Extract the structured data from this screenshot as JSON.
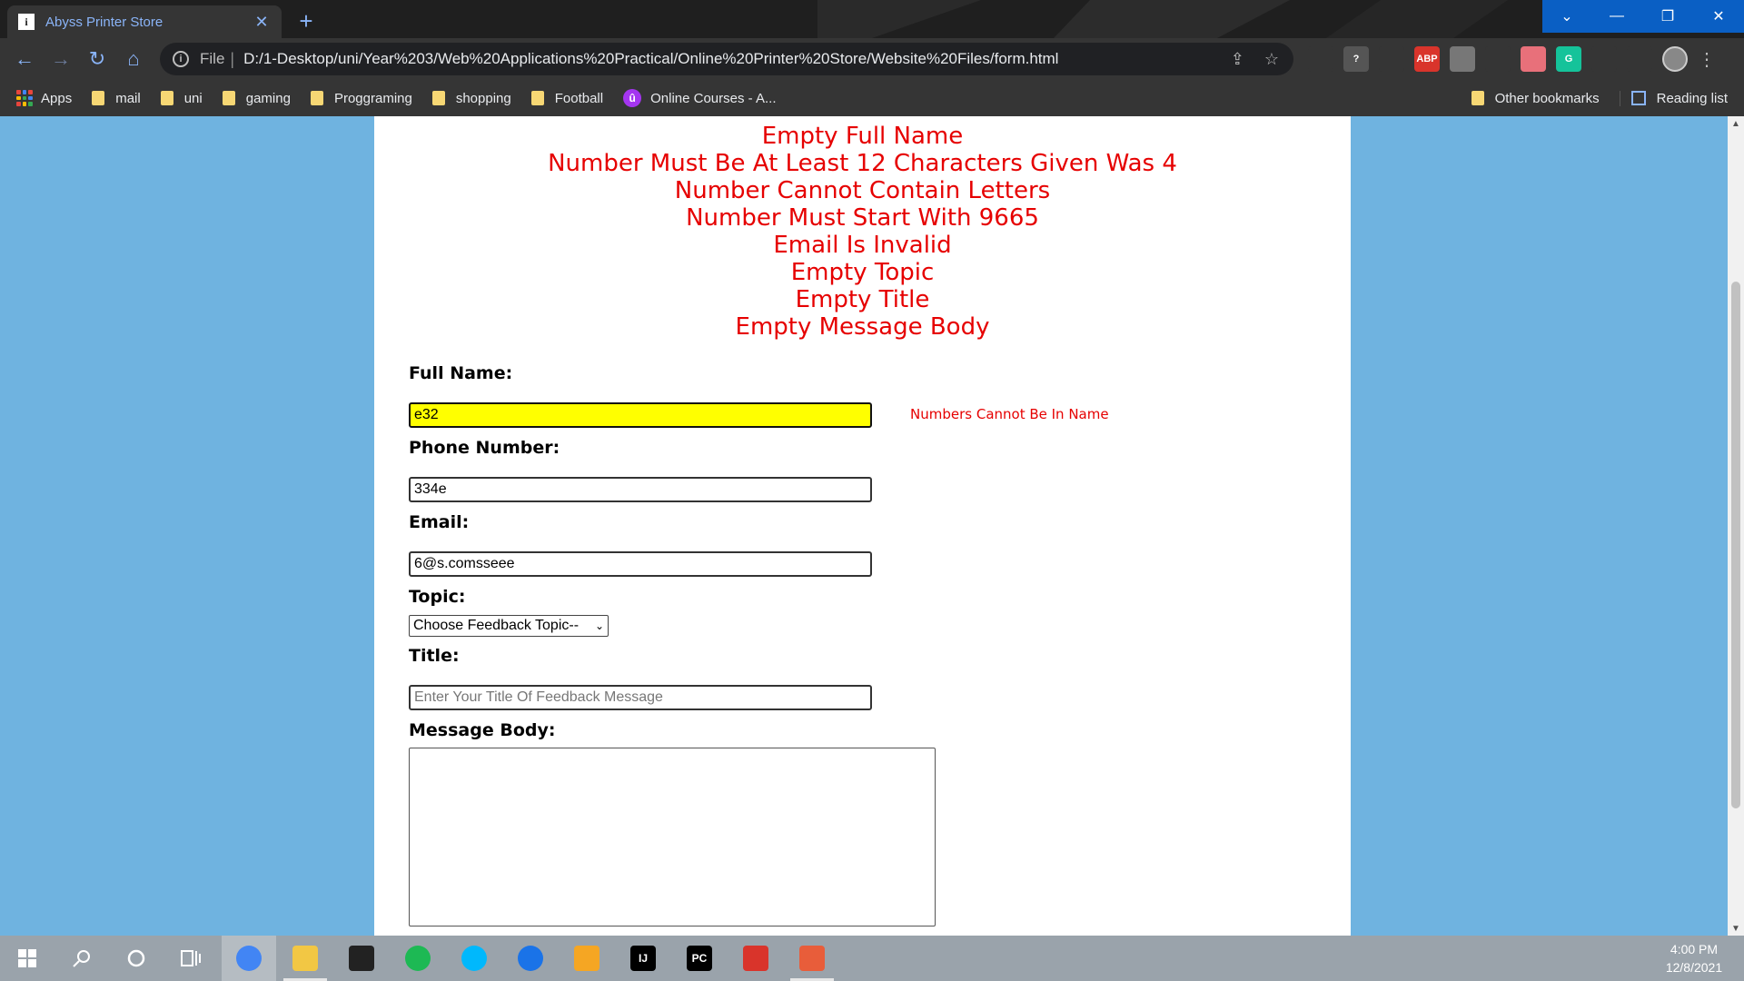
{
  "browser": {
    "tab_title": "Abyss Printer Store",
    "tab_favicon_letter": "i",
    "url_scheme_label": "File",
    "url": "D:/1-Desktop/uni/Year%203/Web%20Applications%20Practical/Online%20Printer%20Store/Website%20Files/form.html",
    "extensions": [
      {
        "icon": "chatgpt-icon",
        "label": "",
        "color": "#353535"
      },
      {
        "icon": "help-icon",
        "label": "?",
        "color": "#555555"
      },
      {
        "icon": "grammar-icon",
        "label": "",
        "color": "#353535"
      },
      {
        "icon": "adblock-icon",
        "label": "ABP",
        "color": "#d9342b"
      },
      {
        "icon": "acrobat-icon",
        "label": "",
        "color": "#777777"
      },
      {
        "icon": "drive-icon",
        "label": "",
        "color": "#353535"
      },
      {
        "icon": "record-icon",
        "label": "",
        "color": "#e8707a"
      },
      {
        "icon": "grammarly-icon",
        "label": "G",
        "color": "#15c39a"
      },
      {
        "icon": "reader-icon",
        "label": "",
        "color": "#353535"
      },
      {
        "icon": "puzzle-icon",
        "label": "",
        "color": "#353535"
      }
    ]
  },
  "bookmarks": {
    "apps_label": "Apps",
    "items": [
      {
        "label": "mail"
      },
      {
        "label": "uni"
      },
      {
        "label": "gaming"
      },
      {
        "label": "Proggraming"
      },
      {
        "label": "shopping"
      },
      {
        "label": "Football"
      }
    ],
    "course_label": "Online Courses - A...",
    "other_label": "Other bookmarks",
    "reading_label": "Reading list"
  },
  "form": {
    "errors": [
      "Empty Full Name",
      "Number Must Be At Least 12 Characters Given Was 4",
      "Number Cannot Contain Letters",
      "Number Must Start With 9665",
      "Email Is Invalid",
      "Empty Topic",
      "Empty Title",
      "Empty Message Body"
    ],
    "name_label": "Full Name:",
    "name_value": "e32",
    "name_error": "Numbers Cannot Be In Name",
    "phone_label": "Phone Number:",
    "phone_value": "334e",
    "email_label": "Email:",
    "email_value": "6@s.comsseee",
    "topic_label": "Topic:",
    "topic_selected": "Choose Feedback Topic--",
    "title_label": "Title:",
    "title_placeholder": "Enter Your Title Of Feedback Message",
    "message_label": "Message Body:",
    "message_value": ""
  },
  "taskbar": {
    "apps": [
      {
        "icon": "chrome-icon",
        "color": "#4285f4",
        "state": "active"
      },
      {
        "icon": "file-explorer-icon",
        "color": "#f2c744",
        "state": "running"
      },
      {
        "icon": "razer-icon",
        "color": "#222222",
        "state": ""
      },
      {
        "icon": "spotify-icon",
        "color": "#1db954",
        "state": ""
      },
      {
        "icon": "logitech-icon",
        "color": "#00b8fc",
        "state": ""
      },
      {
        "icon": "maps-pin-icon",
        "color": "#1a73e8",
        "state": ""
      },
      {
        "icon": "cube-icon",
        "color": "#f5a623",
        "state": ""
      },
      {
        "icon": "intellij-icon",
        "color": "#000000",
        "label": "IJ",
        "state": ""
      },
      {
        "icon": "pycharm-icon",
        "color": "#000000",
        "label": "PC",
        "state": ""
      },
      {
        "icon": "acrobat-icon",
        "color": "#d9342b",
        "state": ""
      },
      {
        "icon": "paint-icon",
        "color": "#e85d3a",
        "state": "running"
      }
    ],
    "time": "4:00 PM",
    "date": "12/8/2021"
  }
}
